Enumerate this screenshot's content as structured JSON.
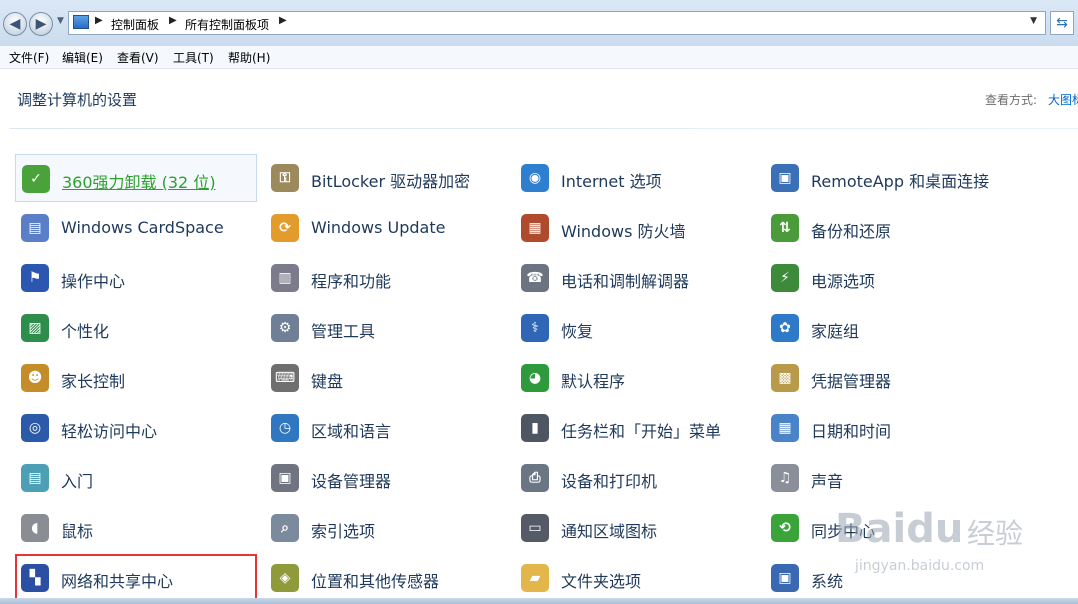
{
  "breadcrumbs": [
    "控制面板",
    "所有控制面板项"
  ],
  "menu": [
    "文件(F)",
    "编辑(E)",
    "查看(V)",
    "工具(T)",
    "帮助(H)"
  ],
  "header": {
    "title": "调整计算机的设置",
    "view_by_label": "查看方式:",
    "view_by_value": "大图标"
  },
  "items": [
    {
      "label": "360强力卸载 (32 位)",
      "icon": "uninstall-icon",
      "color": "#4aa33a",
      "glyph": "✓"
    },
    {
      "label": "BitLocker 驱动器加密",
      "icon": "key-lock-icon",
      "color": "#9c8a5c",
      "glyph": "⚿"
    },
    {
      "label": "Internet 选项",
      "icon": "globe-icon",
      "color": "#2f7fd1",
      "glyph": "◉"
    },
    {
      "label": "RemoteApp 和桌面连接",
      "icon": "remote-desktop-icon",
      "color": "#3b6fb6",
      "glyph": "▣"
    },
    {
      "label": "Windows CardSpace",
      "icon": "cardspace-icon",
      "color": "#5a7fc8",
      "glyph": "▤"
    },
    {
      "label": "Windows Update",
      "icon": "windows-update-icon",
      "color": "#e39b2b",
      "glyph": "⟳"
    },
    {
      "label": "Windows 防火墙",
      "icon": "firewall-icon",
      "color": "#b04a2c",
      "glyph": "▦"
    },
    {
      "label": "备份和还原",
      "icon": "backup-icon",
      "color": "#4c9b3b",
      "glyph": "⇅"
    },
    {
      "label": "操作中心",
      "icon": "flag-icon",
      "color": "#2c57b0",
      "glyph": "⚑"
    },
    {
      "label": "程序和功能",
      "icon": "programs-icon",
      "color": "#7b7b8b",
      "glyph": "▥"
    },
    {
      "label": "电话和调制解调器",
      "icon": "phone-icon",
      "color": "#6b7480",
      "glyph": "☎"
    },
    {
      "label": "电源选项",
      "icon": "power-icon",
      "color": "#3c8a3a",
      "glyph": "⚡"
    },
    {
      "label": "个性化",
      "icon": "personalize-icon",
      "color": "#2f8d4c",
      "glyph": "▨"
    },
    {
      "label": "管理工具",
      "icon": "admin-tools-icon",
      "color": "#6e7f96",
      "glyph": "⚙"
    },
    {
      "label": "恢复",
      "icon": "recovery-icon",
      "color": "#2f66b5",
      "glyph": "⚕"
    },
    {
      "label": "家庭组",
      "icon": "homegroup-icon",
      "color": "#2f7ac8",
      "glyph": "✿"
    },
    {
      "label": "家长控制",
      "icon": "parental-icon",
      "color": "#c58d2a",
      "glyph": "☻"
    },
    {
      "label": "键盘",
      "icon": "keyboard-icon",
      "color": "#6f6f6f",
      "glyph": "⌨"
    },
    {
      "label": "默认程序",
      "icon": "default-programs-icon",
      "color": "#2f9a3c",
      "glyph": "◕"
    },
    {
      "label": "凭据管理器",
      "icon": "credential-icon",
      "color": "#b89a4a",
      "glyph": "▩"
    },
    {
      "label": "轻松访问中心",
      "icon": "ease-access-icon",
      "color": "#2c5aa8",
      "glyph": "◎"
    },
    {
      "label": "区域和语言",
      "icon": "region-icon",
      "color": "#3077c2",
      "glyph": "◷"
    },
    {
      "label": "任务栏和「开始」菜单",
      "icon": "taskbar-icon",
      "color": "#4e5664",
      "glyph": "▮"
    },
    {
      "label": "日期和时间",
      "icon": "calendar-icon",
      "color": "#4a83c8",
      "glyph": "▦"
    },
    {
      "label": "入门",
      "icon": "getting-started-icon",
      "color": "#4d9fb6",
      "glyph": "▤"
    },
    {
      "label": "设备管理器",
      "icon": "device-manager-icon",
      "color": "#6f7480",
      "glyph": "▣"
    },
    {
      "label": "设备和打印机",
      "icon": "printer-icon",
      "color": "#6b7685",
      "glyph": "⎙"
    },
    {
      "label": "声音",
      "icon": "speaker-icon",
      "color": "#8a8f99",
      "glyph": "♫"
    },
    {
      "label": "鼠标",
      "icon": "mouse-icon",
      "color": "#8a8d93",
      "glyph": "◖"
    },
    {
      "label": "索引选项",
      "icon": "index-icon",
      "color": "#7b8a9c",
      "glyph": "⌕"
    },
    {
      "label": "通知区域图标",
      "icon": "notification-icon",
      "color": "#555b66",
      "glyph": "▭"
    },
    {
      "label": "同步中心",
      "icon": "sync-icon",
      "color": "#3aa33a",
      "glyph": "⟲"
    },
    {
      "label": "网络和共享中心",
      "icon": "network-icon",
      "color": "#2c4fa3",
      "glyph": "▚"
    },
    {
      "label": "位置和其他传感器",
      "icon": "location-icon",
      "color": "#8f9a3a",
      "glyph": "◈"
    },
    {
      "label": "文件夹选项",
      "icon": "folder-icon",
      "color": "#e2b64a",
      "glyph": "▰"
    },
    {
      "label": "系统",
      "icon": "system-icon",
      "color": "#3a68b3",
      "glyph": "▣"
    }
  ],
  "watermark": {
    "logo": "Baidu",
    "text": "经验",
    "url": "jingyan.baidu.com"
  }
}
